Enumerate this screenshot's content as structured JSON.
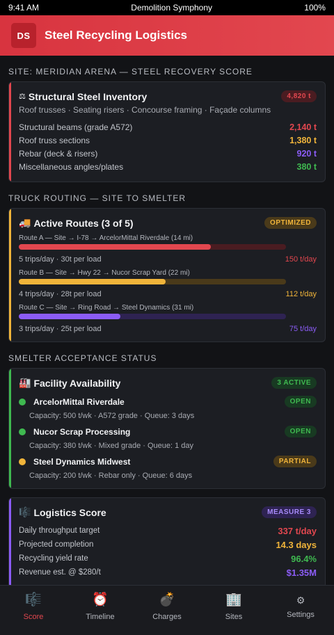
{
  "status_bar": {
    "time": "9:41 AM",
    "title": "Demolition Symphony",
    "battery": "100%"
  },
  "header": {
    "logo": "DS",
    "title": "Steel Recycling Logistics"
  },
  "inventory": {
    "section_title": "Site: Meridian Arena — Steel Recovery Score",
    "icon": "⚖",
    "title": "Structural Steel Inventory",
    "badge": "4,820 t",
    "subtitle": "Roof trusses · Seating risers · Concourse framing · Façade columns",
    "rows": [
      {
        "label": "Structural beams (grade A572)",
        "value": "2,140 t"
      },
      {
        "label": "Roof truss sections",
        "value": "1,380 t"
      },
      {
        "label": "Rebar (deck & risers)",
        "value": "920 t"
      },
      {
        "label": "Miscellaneous angles/plates",
        "value": "380 t"
      }
    ]
  },
  "routing": {
    "section_title": "Truck Routing — Site to Smelter",
    "icon": "🚚",
    "title": "Active Routes (3 of 5)",
    "badge": "OPTIMIZED",
    "routes": [
      {
        "label": "Route A — Site → I-78 → ArcelorMittal Riverdale (14 mi)",
        "meta": "5 trips/day · 30t per load",
        "rate": "150 t/day",
        "fill": 0.72,
        "color": "#e2474f",
        "track": "#4a1c21"
      },
      {
        "label": "Route B — Site → Hwy 22 → Nucor Scrap Yard (22 mi)",
        "meta": "4 trips/day · 28t per load",
        "rate": "112 t/day",
        "fill": 0.55,
        "color": "#f0b43a",
        "track": "#4a3a1a"
      },
      {
        "label": "Route C — Site → Ring Road → Steel Dynamics (31 mi)",
        "meta": "3 trips/day · 25t per load",
        "rate": "75 t/day",
        "fill": 0.38,
        "color": "#8b5cf6",
        "track": "#2e2352"
      }
    ]
  },
  "smelters": {
    "section_title": "Smelter Acceptance Status",
    "icon": "🏭",
    "title": "Facility Availability",
    "badge": "3 ACTIVE",
    "facilities": [
      {
        "name": "ArcelorMittal Riverdale",
        "status": "OPEN",
        "meta": "Capacity: 500 t/wk · A572 grade · Queue: 3 days",
        "dot": "#3fb950"
      },
      {
        "name": "Nucor Scrap Processing",
        "status": "OPEN",
        "meta": "Capacity: 380 t/wk · Mixed grade · Queue: 1 day",
        "dot": "#3fb950"
      },
      {
        "name": "Steel Dynamics Midwest",
        "status": "PARTIAL",
        "meta": "Capacity: 200 t/wk · Rebar only · Queue: 6 days",
        "dot": "#f0b43a"
      }
    ]
  },
  "score": {
    "icon": "🎼",
    "title": "Logistics Score",
    "badge": "MEASURE 3",
    "rows": [
      {
        "label": "Daily throughput target",
        "value": "337 t/day"
      },
      {
        "label": "Projected completion",
        "value": "14.3 days"
      },
      {
        "label": "Recycling yield rate",
        "value": "96.4%"
      },
      {
        "label": "Revenue est. @ $280/t",
        "value": "$1.35M"
      }
    ]
  },
  "tabs": [
    {
      "label": "Score",
      "icon": "🎼"
    },
    {
      "label": "Timeline",
      "icon": "⏰"
    },
    {
      "label": "Charges",
      "icon": "💣"
    },
    {
      "label": "Sites",
      "icon": "🏢"
    },
    {
      "label": "Settings",
      "icon": "⚙"
    }
  ],
  "colors": {
    "accent": "#e2474f",
    "orange": "#f0b43a",
    "green": "#3fb950",
    "purple": "#8b5cf6"
  }
}
